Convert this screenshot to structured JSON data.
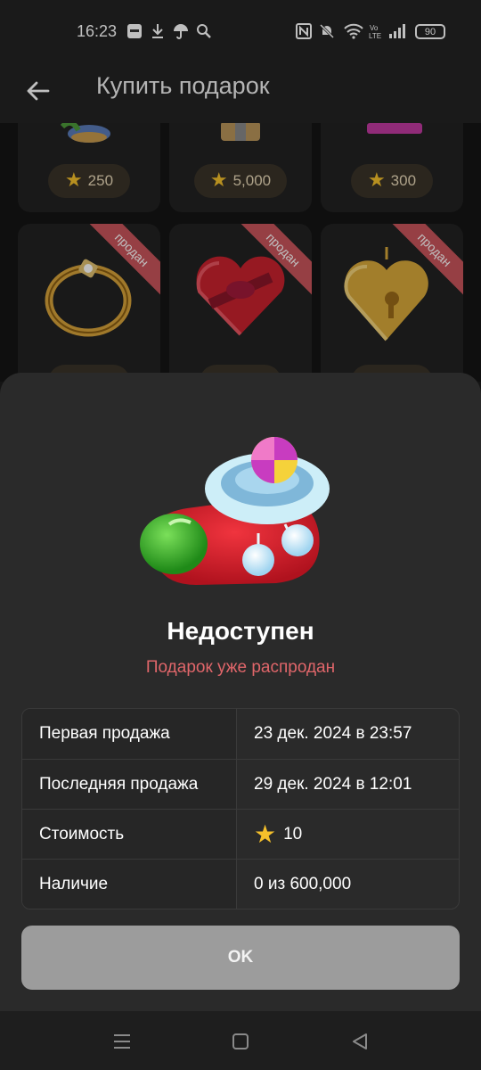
{
  "status_bar": {
    "time": "16:23",
    "battery": "90",
    "icons": [
      "app-notification-icon",
      "download-icon",
      "umbrella-icon",
      "search-icon",
      "nfc-icon",
      "bell-off-icon",
      "wifi-icon",
      "volte-icon",
      "signal-icon",
      "battery-icon"
    ]
  },
  "app_bar": {
    "back_icon": "arrow-left-icon",
    "title": "Купить подарок"
  },
  "grid": {
    "top_row_prices": [
      "250",
      "5,000",
      "300"
    ],
    "sold_badge": "продан",
    "second_row_items": [
      "ring",
      "heart-gift-box",
      "heart-locket"
    ]
  },
  "sheet": {
    "title": "Недоступен",
    "subtitle": "Подарок уже распродан",
    "rows": [
      {
        "label": "Первая продажа",
        "value": "23 дек. 2024 в 23:57"
      },
      {
        "label": "Последняя продажа",
        "value": "29 дек. 2024 в 12:01"
      },
      {
        "label": "Стоимость",
        "value": "10"
      },
      {
        "label": "Наличие",
        "value": "0 из 600,000"
      }
    ],
    "ok_label": "OK"
  },
  "colors": {
    "accent_red": "#e0666a",
    "star": "#f5c02b",
    "sheet_bg": "#2a2a2a",
    "button_bg": "#9c9c9c"
  }
}
